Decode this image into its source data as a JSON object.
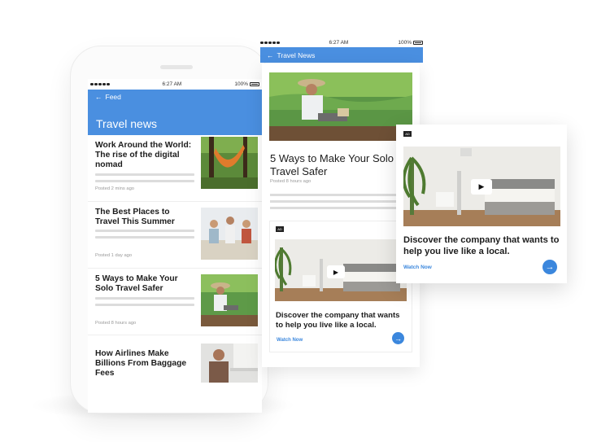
{
  "phone": {
    "status": {
      "time": "6:27 AM",
      "battery": "100%"
    },
    "nav": {
      "back_label": "Feed",
      "section_title": "Travel news"
    },
    "feed": [
      {
        "title": "Work Around the World: The rise of the digital nomad",
        "time": "Posted 2 mins ago",
        "thumb": "hammock-photo"
      },
      {
        "title": "The Best Places to Travel This Summer",
        "time": "Posted 1 day ago",
        "thumb": "friends-beach-photo"
      },
      {
        "title": "5 Ways to Make Your Solo Travel Safer",
        "time": "Posted 8 hours ago",
        "thumb": "traveler-hill-photo"
      },
      {
        "title": "How Airlines Make Billions From Baggage Fees",
        "time": "",
        "thumb": "office-photo"
      }
    ]
  },
  "tablet": {
    "status": {
      "time": "6:27 AM",
      "battery": "100%"
    },
    "nav": {
      "back_label": "Travel News"
    },
    "article": {
      "title": "5 Ways to Make Your Solo Travel Safer",
      "time": "Posted 8 hours ago"
    },
    "ad": {
      "badge": "AD",
      "headline": "Discover the company that wants to help you live like a local.",
      "cta": "Watch Now"
    }
  },
  "float_ad": {
    "badge": "AD",
    "headline": "Discover the company that wants to help you live like a local.",
    "cta": "Watch Now"
  },
  "colors": {
    "accent": "#4a8fe0",
    "cta": "#3b87dd"
  }
}
